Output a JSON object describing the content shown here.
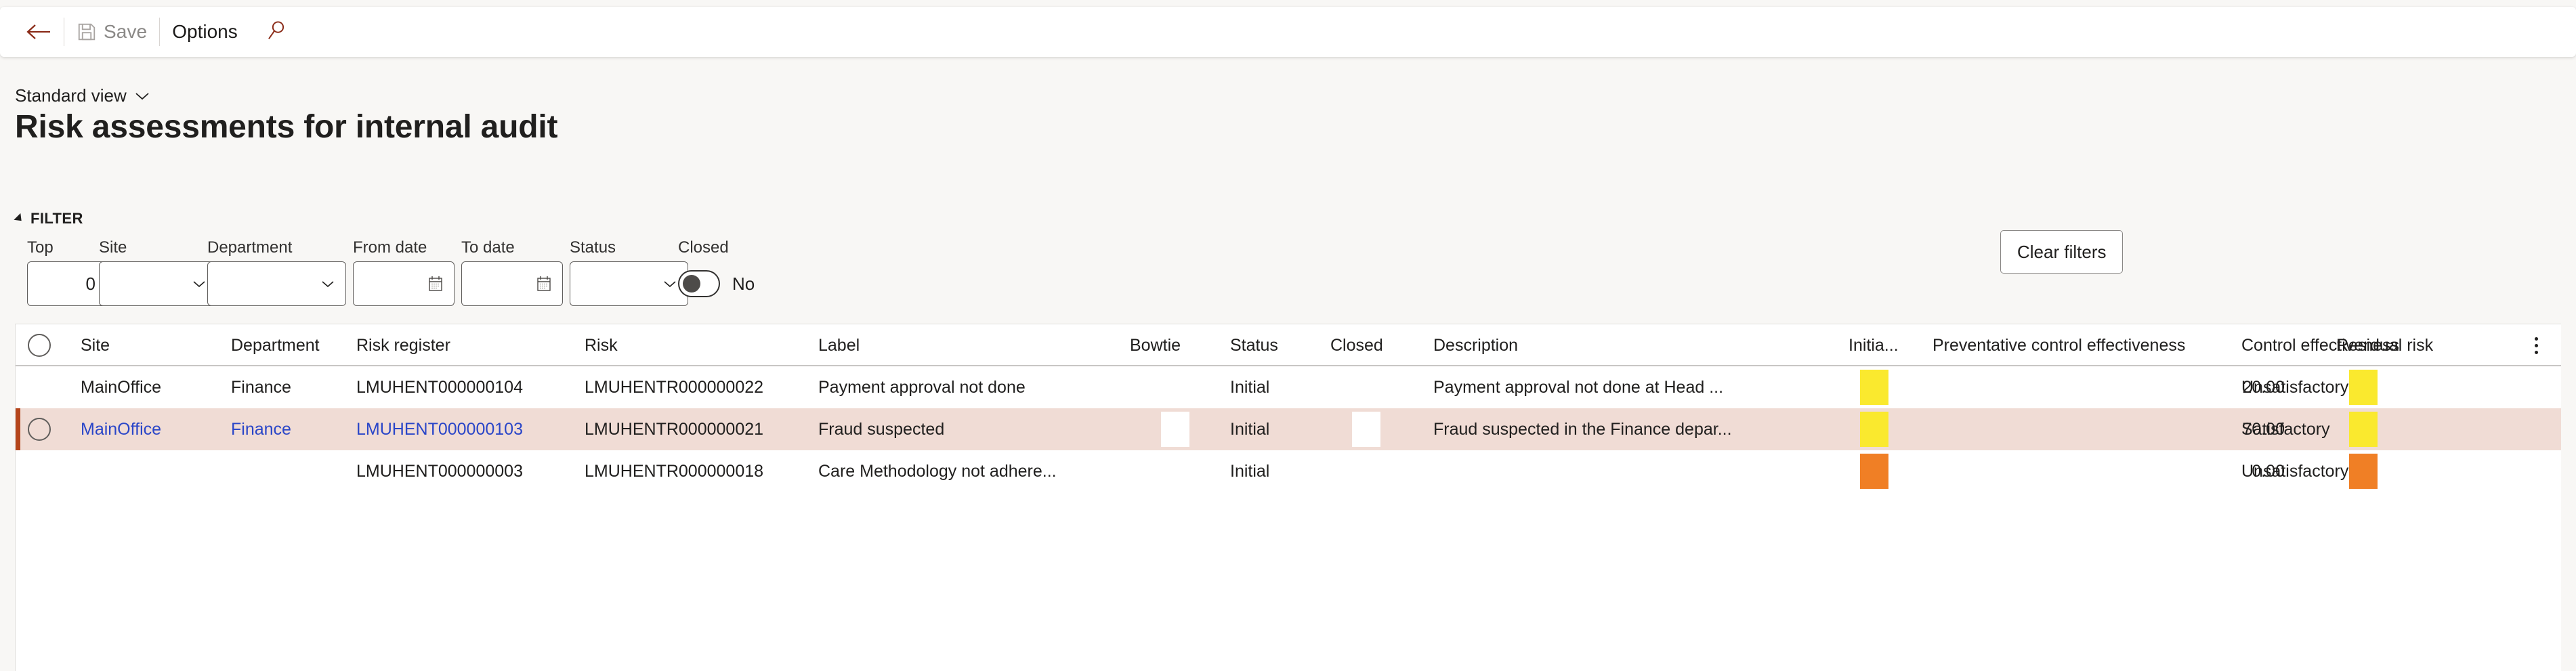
{
  "commandbar": {
    "back_icon": "back-arrow-icon",
    "save_icon": "save-disk-icon",
    "save_label": "Save",
    "options_label": "Options",
    "search_icon": "search-icon"
  },
  "view_selector": {
    "label": "Standard view",
    "chevron_icon": "chevron-down-icon"
  },
  "page_title": "Risk assessments for internal audit",
  "filter": {
    "section_title": "FILTER",
    "caret_icon": "caret-expanded-icon",
    "fields": [
      {
        "label": "Top",
        "value": "0",
        "kind": "number",
        "align": "right"
      },
      {
        "label": "Site",
        "value": "",
        "kind": "dropdown"
      },
      {
        "label": "Department",
        "value": "",
        "kind": "dropdown"
      },
      {
        "label": "From date",
        "value": "",
        "kind": "date"
      },
      {
        "label": "To date",
        "value": "",
        "kind": "date"
      },
      {
        "label": "Status",
        "value": "",
        "kind": "dropdown"
      }
    ],
    "closed_toggle": {
      "label": "Closed",
      "state_text": "No",
      "checked": false
    },
    "clear_filters_label": "Clear filters"
  },
  "grid": {
    "select_all_icon": "row-select-circle-icon",
    "overflow_icon": "kebab-menu-icon",
    "columns": [
      "Site",
      "Department",
      "Risk register",
      "Risk",
      "Label",
      "Bowtie",
      "Status",
      "Closed",
      "Description",
      "Initia...",
      "Preventative control effectiveness",
      "Control effectiveness",
      "Residual risk"
    ],
    "rows": [
      {
        "selected": false,
        "site": "MainOffice",
        "department": "Finance",
        "risk_register": "LMUHENT000000104",
        "risk": "LMUHENTR000000022",
        "label": "Payment approval not done",
        "bowtie": "",
        "status": "Initial",
        "closed": "",
        "description": "Payment approval not done at Head ...",
        "initial_risk_color": "#fae92e",
        "preventative_control_effectiveness": "20.00",
        "control_effectiveness": "Unsatisfactory",
        "residual_risk_color": "#fae92e"
      },
      {
        "selected": true,
        "site": "MainOffice",
        "department": "Finance",
        "risk_register": "LMUHENT000000103",
        "risk": "LMUHENTR000000021",
        "label": "Fraud suspected",
        "bowtie": "",
        "status": "Initial",
        "closed": "",
        "description": "Fraud suspected in the Finance depar...",
        "initial_risk_color": "#fae92e",
        "preventative_control_effectiveness": "70.00",
        "control_effectiveness": "Satisfactory",
        "residual_risk_color": "#fae92e"
      },
      {
        "selected": false,
        "site": "",
        "department": "",
        "risk_register": "LMUHENT000000003",
        "risk": "LMUHENTR000000018",
        "label": "Care Methodology not adhere...",
        "bowtie": "",
        "status": "Initial",
        "closed": "",
        "description": "",
        "initial_risk_color": "#f07f25",
        "preventative_control_effectiveness": "0.00",
        "control_effectiveness": "Unsatisfactory",
        "residual_risk_color": "#f07f25"
      }
    ]
  },
  "colors": {
    "accent_brand": "#8a2a17",
    "selected_row_bg": "#f0dcd5",
    "selected_row_marker": "#b5451b",
    "link": "#2a46c8",
    "risk_yellow": "#fae92e",
    "risk_orange": "#f07f25"
  }
}
